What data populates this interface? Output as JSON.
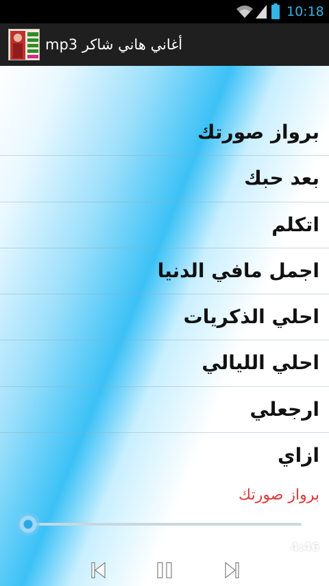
{
  "status_bar": {
    "time": "10:18",
    "icons": [
      "wifi-icon",
      "signal-icon",
      "battery-icon"
    ],
    "accent_color": "#33b5e5"
  },
  "action_bar": {
    "title": "أغاني هاني شاكر mp3",
    "icon": "app-icon"
  },
  "songs": [
    {
      "title": "برواز صورتك"
    },
    {
      "title": "بعد حبك"
    },
    {
      "title": "اتكلم"
    },
    {
      "title": "اجمل مافي الدنيا"
    },
    {
      "title": "احلي الذكريات"
    },
    {
      "title": "احلي الليالي"
    },
    {
      "title": "ارجعلي"
    },
    {
      "title": "ازاي"
    }
  ],
  "player": {
    "now_playing": "برواز صورتك",
    "now_playing_color": "#e0393a",
    "duration": "4:46",
    "progress": 0,
    "controls": [
      "previous-icon",
      "pause-icon",
      "next-icon"
    ]
  }
}
